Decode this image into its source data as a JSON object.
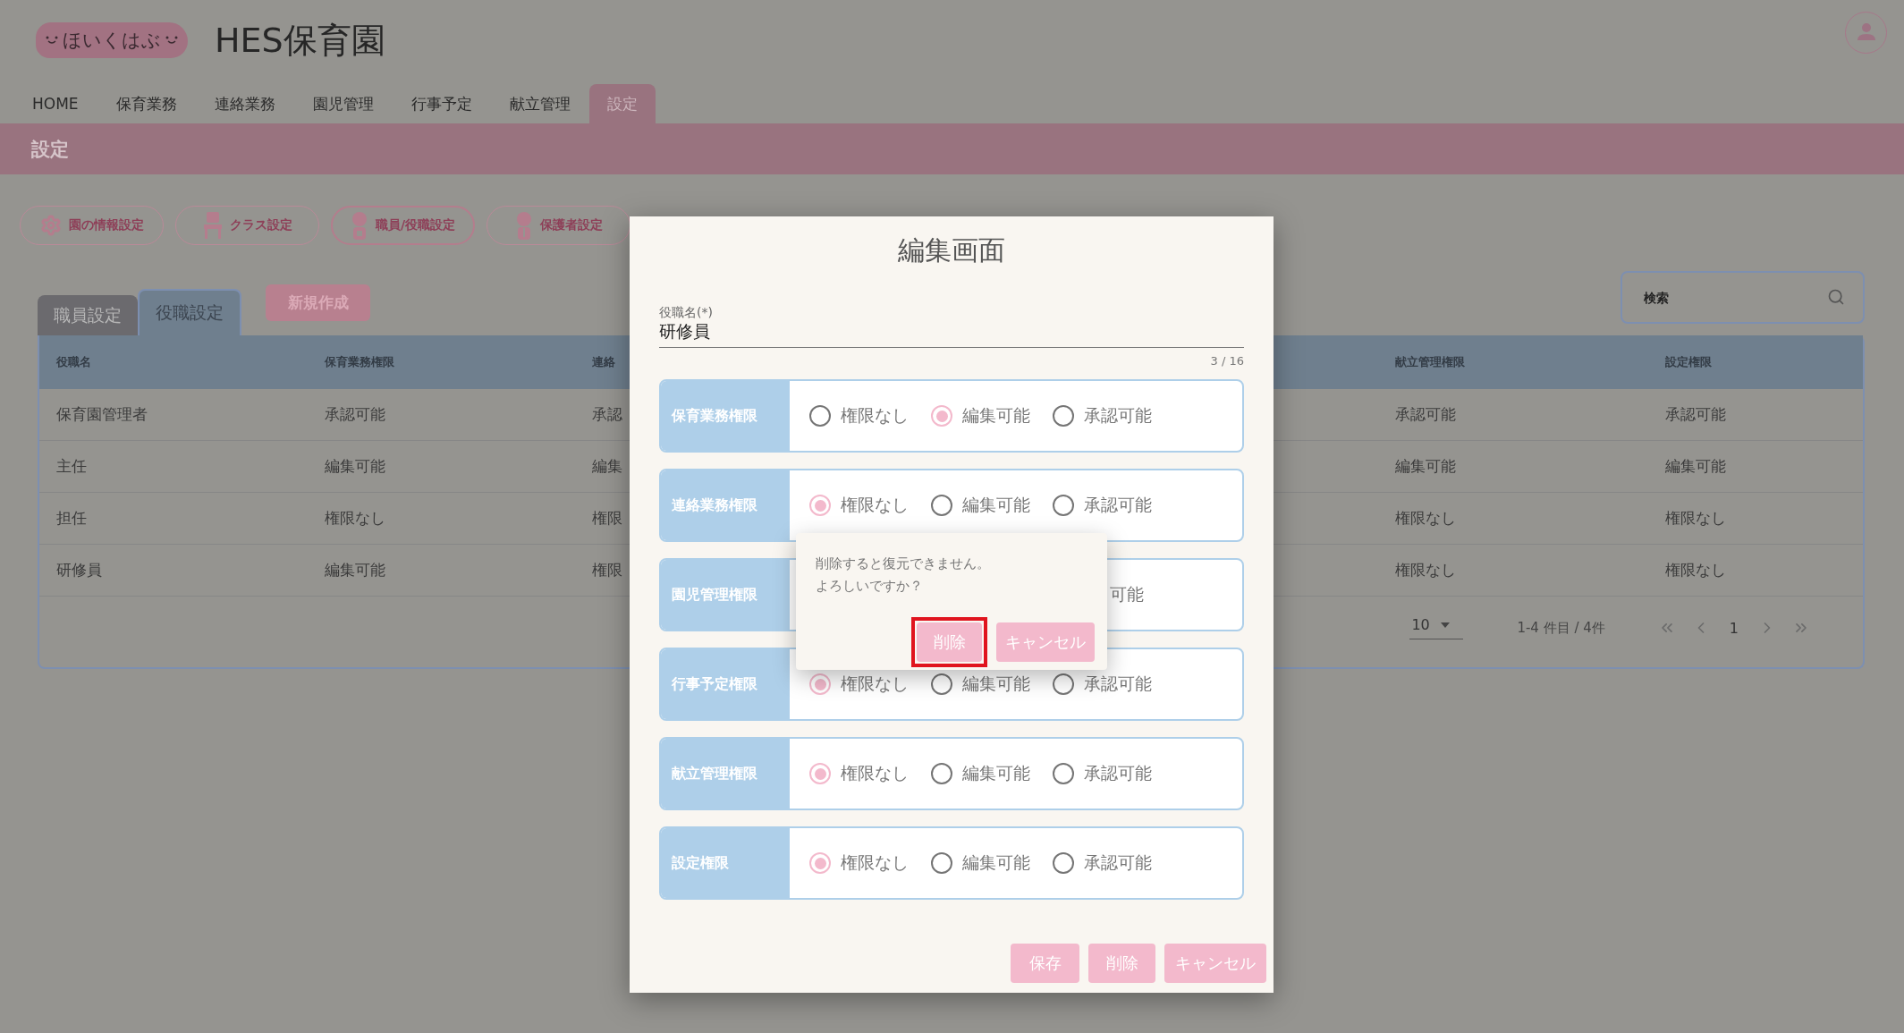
{
  "header": {
    "logo": "ほいくはぶ",
    "title": "HES保育園"
  },
  "nav": [
    {
      "label": "HOME",
      "selected": false
    },
    {
      "label": "保育業務",
      "selected": false
    },
    {
      "label": "連絡業務",
      "selected": false
    },
    {
      "label": "園児管理",
      "selected": false
    },
    {
      "label": "行事予定",
      "selected": false
    },
    {
      "label": "献立管理",
      "selected": false
    },
    {
      "label": "設定",
      "selected": true
    }
  ],
  "page_title": "設定",
  "settings_buttons": [
    {
      "label": "園の情報設定",
      "kind": "gear",
      "selected": false
    },
    {
      "label": "クラス設定",
      "kind": "chair",
      "selected": false
    },
    {
      "label": "職員/役職設定",
      "kind": "staff",
      "selected": true
    },
    {
      "label": "保護者設定",
      "kind": "parent",
      "selected": false
    }
  ],
  "tabs": [
    {
      "label": "職員設定",
      "selected": false
    },
    {
      "label": "役職設定",
      "selected": true
    }
  ],
  "new_button": "新規作成",
  "search": {
    "placeholder": "検索"
  },
  "table": {
    "columns": [
      "役職名",
      "保育業務権限",
      "連絡",
      "献立管理権限",
      "設定権限"
    ],
    "rows": [
      [
        "保育園管理者",
        "承認可能",
        "承認",
        "承認可能",
        "承認可能"
      ],
      [
        "主任",
        "編集可能",
        "編集",
        "編集可能",
        "編集可能"
      ],
      [
        "担任",
        "権限なし",
        "権限",
        "権限なし",
        "権限なし"
      ],
      [
        "研修員",
        "編集可能",
        "権限",
        "権限なし",
        "権限なし"
      ]
    ]
  },
  "pagination": {
    "per_page": "10",
    "range": "1-4 件目 / 4件",
    "page": "1"
  },
  "dialog": {
    "title": "編集画面",
    "field": {
      "label": "役職名(*)",
      "value": "研修員",
      "counter": "3 / 16"
    },
    "permissions": [
      {
        "label": "保育業務権限",
        "options": [
          {
            "label": "権限なし",
            "selected": false
          },
          {
            "label": "編集可能",
            "selected": true
          },
          {
            "label": "承認可能",
            "selected": false
          }
        ]
      },
      {
        "label": "連絡業務権限",
        "options": [
          {
            "label": "権限なし",
            "selected": true
          },
          {
            "label": "編集可能",
            "selected": false
          },
          {
            "label": "承認可能",
            "selected": false
          }
        ]
      },
      {
        "label": "園児管理権限",
        "options": [
          {
            "label": "可能"
          }
        ]
      },
      {
        "label": "行事予定権限",
        "options": [
          {
            "label": "権限なし",
            "selected": true
          },
          {
            "label": "編集可能",
            "selected": false
          },
          {
            "label": "承認可能",
            "selected": false
          }
        ]
      },
      {
        "label": "献立管理権限",
        "options": [
          {
            "label": "権限なし",
            "selected": true
          },
          {
            "label": "編集可能",
            "selected": false
          },
          {
            "label": "承認可能",
            "selected": false
          }
        ]
      },
      {
        "label": "設定権限",
        "options": [
          {
            "label": "権限なし",
            "selected": true
          },
          {
            "label": "編集可能",
            "selected": false
          },
          {
            "label": "承認可能",
            "selected": false
          }
        ]
      }
    ],
    "buttons": [
      "保存",
      "削除",
      "キャンセル"
    ]
  },
  "confirm": {
    "message_lines": [
      "削除すると復元できません。",
      "よろしいですか？"
    ],
    "buttons": [
      {
        "label": "削除",
        "highlighted": true
      },
      {
        "label": "キャンセル",
        "highlighted": false
      }
    ]
  }
}
